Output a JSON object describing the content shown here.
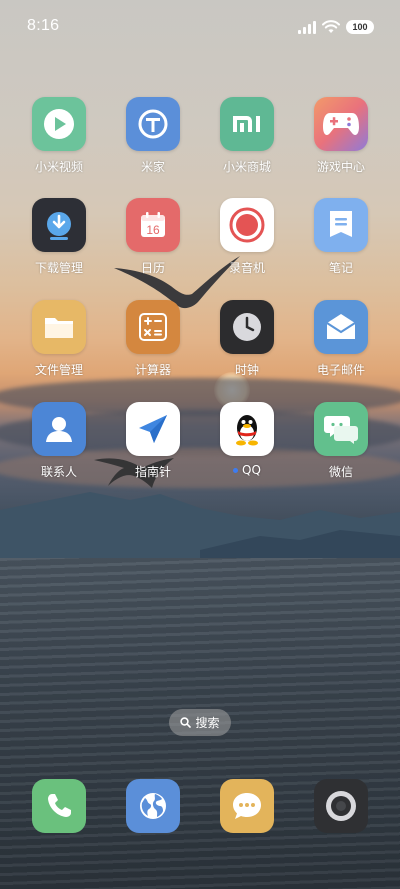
{
  "status_bar": {
    "time": "8:16",
    "battery": "100",
    "signal_icon": "cellular-signal-icon",
    "wifi_icon": "wifi-icon"
  },
  "apps": [
    {
      "label": "小米视频",
      "icon": "play-icon",
      "color": "#6cc39b"
    },
    {
      "label": "米家",
      "icon": "mijia-icon",
      "color": "#5b8fd9"
    },
    {
      "label": "小米商城",
      "icon": "mi-logo-icon",
      "color": "#5fb894"
    },
    {
      "label": "游戏中心",
      "icon": "gamepad-icon",
      "color": "#e98a7a"
    },
    {
      "label": "下载管理",
      "icon": "download-icon",
      "color": "#2d2f36"
    },
    {
      "label": "日历",
      "icon": "calendar-icon",
      "color": "#e46a6a",
      "calendar_day": "16"
    },
    {
      "label": "录音机",
      "icon": "record-icon",
      "color": "#ffffff"
    },
    {
      "label": "笔记",
      "icon": "notes-icon",
      "color": "#7fb0ee"
    },
    {
      "label": "文件管理",
      "icon": "folder-icon",
      "color": "#e7b866"
    },
    {
      "label": "计算器",
      "icon": "calculator-icon",
      "color": "#d4873f"
    },
    {
      "label": "时钟",
      "icon": "clock-icon",
      "color": "#2c2c2e"
    },
    {
      "label": "电子邮件",
      "icon": "mail-icon",
      "color": "#5b95d8"
    },
    {
      "label": "联系人",
      "icon": "contact-icon",
      "color": "#4c86d6"
    },
    {
      "label": "指南针",
      "icon": "compass-icon",
      "color": "#ffffff"
    },
    {
      "label": "QQ",
      "icon": "qq-penguin-icon",
      "color": "#ffffff"
    },
    {
      "label": "微信",
      "icon": "wechat-icon",
      "color": "#62c08d"
    }
  ],
  "search": {
    "label": "搜索",
    "icon": "search-icon"
  },
  "dock": [
    {
      "name": "phone",
      "icon": "phone-icon",
      "color": "#6ac17d"
    },
    {
      "name": "browser",
      "icon": "globe-icon",
      "color": "#5b8fd9"
    },
    {
      "name": "messages",
      "icon": "message-icon",
      "color": "#e3b45b"
    },
    {
      "name": "camera",
      "icon": "camera-icon",
      "color": "#2f3033"
    }
  ]
}
